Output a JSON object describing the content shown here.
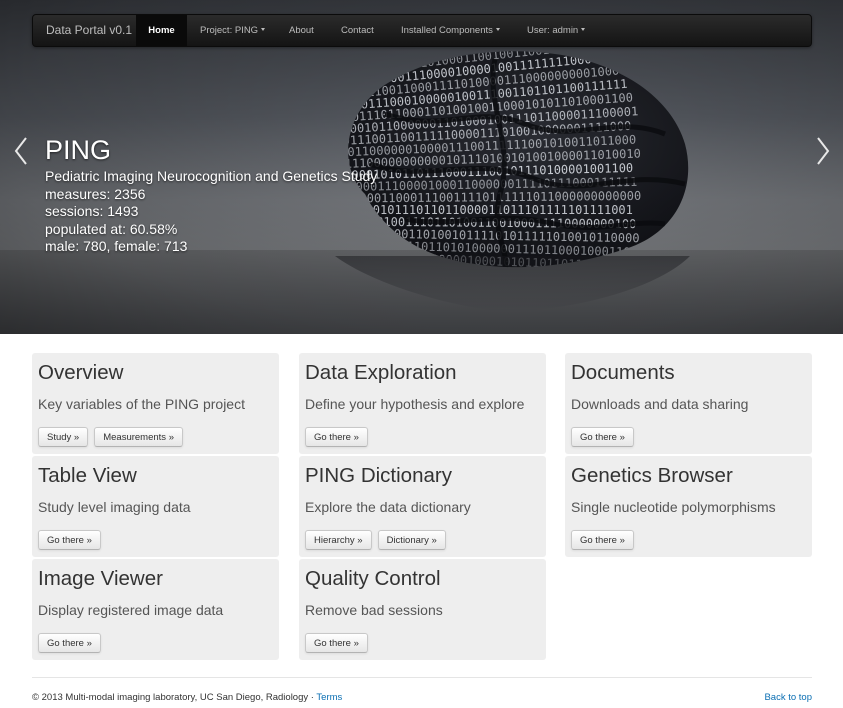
{
  "navbar": {
    "brand": "Data Portal v0.1",
    "items": [
      {
        "label": "Home",
        "active": true
      },
      {
        "label": "Project: PING",
        "dropdown": true
      },
      {
        "label": "About"
      },
      {
        "label": "Contact"
      },
      {
        "label": "Installed Components",
        "dropdown": true
      },
      {
        "label": "User: admin",
        "dropdown": true
      }
    ]
  },
  "hero": {
    "title": "PING",
    "subtitle": "Pediatric Imaging Neurocognition and Genetics Study",
    "measures": "measures: 2356",
    "sessions": "sessions: 1493",
    "populated": "populated at: 60.58%",
    "gender": "male: 780, female: 713",
    "prev_icon": "chevron-left-icon",
    "next_icon": "chevron-right-icon"
  },
  "cards": [
    {
      "title": "Overview",
      "desc": "Key variables of the PING project",
      "buttons": [
        "Study »",
        "Measurements »"
      ]
    },
    {
      "title": "Data Exploration",
      "desc": "Define your hypothesis and explore",
      "buttons": [
        "Go there »"
      ]
    },
    {
      "title": "Documents",
      "desc": "Downloads and data sharing",
      "buttons": [
        "Go there »"
      ]
    },
    {
      "title": "Table View",
      "desc": "Study level imaging data",
      "buttons": [
        "Go there »"
      ]
    },
    {
      "title": "PING Dictionary",
      "desc": "Explore the data dictionary",
      "buttons": [
        "Hierarchy »",
        "Dictionary »"
      ]
    },
    {
      "title": "Genetics Browser",
      "desc": "Single nucleotide polymorphisms",
      "buttons": [
        "Go there »"
      ]
    },
    {
      "title": "Image Viewer",
      "desc": "Display registered image data",
      "buttons": [
        "Go there »"
      ]
    },
    {
      "title": "Quality Control",
      "desc": "Remove bad sessions",
      "buttons": [
        "Go there »"
      ]
    }
  ],
  "footer": {
    "copyright": "© 2013 Multi-modal imaging laboratory, UC San Diego, Radiology · ",
    "terms": "Terms",
    "back_to_top": "Back to top"
  },
  "colors": {
    "navbar_bg": "#1b1b1b",
    "card_bg": "#eeeeee",
    "link": "#0b6fb3"
  }
}
